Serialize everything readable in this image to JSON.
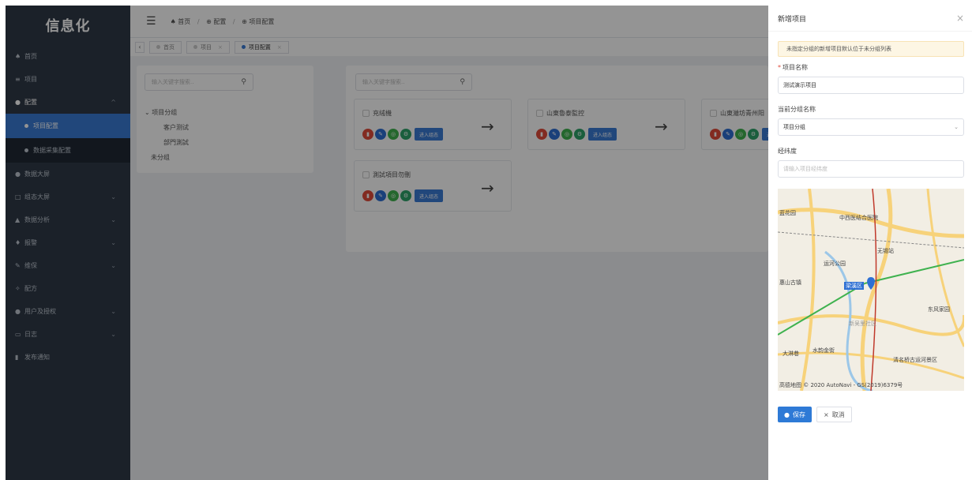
{
  "app": {
    "logo": "信息化"
  },
  "sidebar": {
    "items": [
      {
        "label": "首页",
        "icon": "home-icon",
        "glyph": "♠"
      },
      {
        "label": "项目",
        "icon": "list-icon",
        "glyph": "≡"
      },
      {
        "label": "配置",
        "icon": "settings-icon",
        "glyph": "●",
        "arrow": "^"
      },
      {
        "label": "项目配置",
        "sub": true,
        "active": true
      },
      {
        "label": "数据采集配置",
        "sub": true
      },
      {
        "label": "数据大屏",
        "icon": "dashboard-icon",
        "glyph": "●"
      },
      {
        "label": "组态大屏",
        "icon": "monitor-icon",
        "glyph": "□",
        "arrow": "⌄"
      },
      {
        "label": "数据分析",
        "icon": "chart-icon",
        "glyph": "▲",
        "arrow": "⌄"
      },
      {
        "label": "报警",
        "icon": "bell-icon",
        "glyph": "♦",
        "arrow": "⌄"
      },
      {
        "label": "维保",
        "icon": "wrench-icon",
        "glyph": "✎",
        "arrow": "⌄"
      },
      {
        "label": "配方",
        "icon": "formula-icon",
        "glyph": "✧"
      },
      {
        "label": "用户及授权",
        "icon": "user-icon",
        "glyph": "●",
        "arrow": "⌄"
      },
      {
        "label": "日志",
        "icon": "log-icon",
        "glyph": "▭",
        "arrow": "⌄"
      },
      {
        "label": "发布通知",
        "icon": "notice-icon",
        "glyph": "▮"
      }
    ]
  },
  "breadcrumb": {
    "home": "首页",
    "level1": "配置",
    "level2": "项目配置"
  },
  "tabs": [
    {
      "label": "首页"
    },
    {
      "label": "项目"
    },
    {
      "label": "项目配置",
      "active": true
    }
  ],
  "left_panel": {
    "search_placeholder": "输入关键字搜索..",
    "tree": {
      "group": "项目分组",
      "children": [
        "客户测试",
        "部門測試"
      ],
      "ungrouped": "未分组"
    }
  },
  "right_panel": {
    "search_placeholder": "输入关键字搜索..",
    "enter_label": "进入组态",
    "cards": [
      {
        "name": "充绒機"
      },
      {
        "name": "山東魯泰監控"
      },
      {
        "name": "山東濰坊青州阳"
      },
      {
        "name": "測試項目勿刪"
      }
    ]
  },
  "drawer": {
    "title": "新增项目",
    "notice": "未指定分组的新增项目默认位于未分组列表",
    "name_label": "项目名称",
    "name_value": "测试演示项目",
    "group_label": "当前分组名称",
    "group_value": "项目分组",
    "coord_label": "经纬度",
    "coord_placeholder": "请输入项目经纬度",
    "map": {
      "labels": [
        "蓝花园",
        "中西医结合医院",
        "无锡站",
        "运河公园",
        "惠山古镇",
        "梁溪区",
        "东风家园",
        "新吴里社区",
        "大淋巷",
        "水韵金街",
        "清名桥古运河景区"
      ],
      "attribution": "高德地图 © 2020 AutoNavi - GS(2019)6379号"
    },
    "save_label": "保存",
    "cancel_label": "取消"
  }
}
